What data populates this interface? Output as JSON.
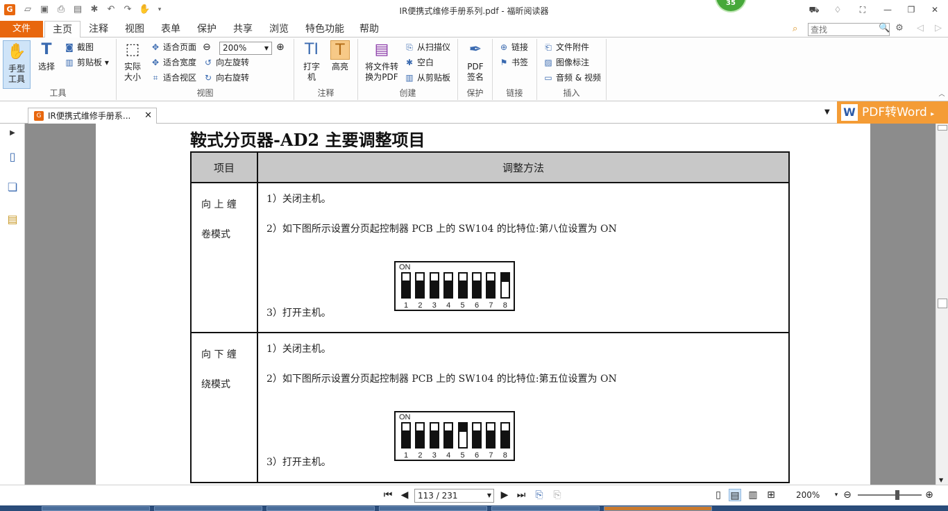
{
  "window": {
    "title": "IR便携式维修手册系列.pdf - 福昕阅读器",
    "notification_count": "35"
  },
  "menu": {
    "file": "文件",
    "tabs": [
      "主页",
      "注释",
      "视图",
      "表单",
      "保护",
      "共享",
      "浏览",
      "特色功能",
      "帮助"
    ],
    "active_tab": "主页",
    "search_placeholder": "查找"
  },
  "ribbon": {
    "tools": {
      "label": "工具",
      "hand": "手型工具",
      "select": "选择",
      "screenshot": "截图",
      "clipboard": "剪贴板"
    },
    "view": {
      "label": "视图",
      "actual_size": "实际大小",
      "fit_page": "适合页面",
      "fit_width": "适合宽度",
      "fit_view": "适合视区",
      "zoom": "200%",
      "rotate_left": "向左旋转",
      "rotate_right": "向右旋转"
    },
    "annotate": {
      "label": "注释",
      "typewriter": "打字机",
      "highlight": "高亮"
    },
    "create": {
      "label": "创建",
      "convert": "将文件转换为PDF",
      "from_scanner": "从扫描仪",
      "blank": "空白",
      "from_clipboard": "从剪贴板"
    },
    "protect": {
      "label": "保护",
      "pdf_sign": "PDF签名"
    },
    "links": {
      "label": "链接",
      "link": "链接",
      "bookmark": "书签"
    },
    "insert": {
      "label": "插入",
      "attachment": "文件附件",
      "image_annotation": "图像标注",
      "audio_video": "音频 & 视频"
    }
  },
  "doc_tab": {
    "title": "IR便携式维修手册系..."
  },
  "promo": {
    "label": "PDF转Word",
    "icon_letter": "W"
  },
  "document": {
    "heading": "鞍式分页器-AD2 主要调整项目",
    "table": {
      "headers": [
        "项目",
        "调整方法"
      ],
      "rows": [
        {
          "mode": [
            "向 上 缠",
            "卷模式"
          ],
          "steps": [
            "1）关闭主机。",
            "2）如下图所示设置分页起控制器 PCB 上的 SW104 的比特位:第八位设置为 ON",
            "3）打开主机。"
          ],
          "dip_on": [
            8
          ]
        },
        {
          "mode": [
            "向 下 缠",
            "绕模式"
          ],
          "steps": [
            "1）关闭主机。",
            "2）如下图所示设置分页起控制器 PCB 上的 SW104 的比特位:第五位设置为 ON",
            "3）打开主机。"
          ],
          "dip_on": [
            5
          ]
        }
      ],
      "dip_label": "ON",
      "dip_numbers": [
        "1",
        "2",
        "3",
        "4",
        "5",
        "6",
        "7",
        "8"
      ]
    }
  },
  "status": {
    "page": "113 / 231",
    "zoom": "200%"
  }
}
